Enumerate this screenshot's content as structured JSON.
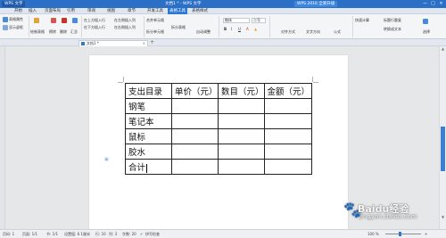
{
  "app": {
    "name": "WPS 文字",
    "title": "文档1 * - WPS 文字",
    "upgrade_label": "WPS 2016 全新升级",
    "window_controls": [
      "—",
      "□",
      "×"
    ]
  },
  "menu": {
    "items": [
      "开始",
      "插入",
      "页面布局",
      "引用",
      "审阅",
      "视图",
      "章节",
      "开发工具",
      "表格工具",
      "表格样式"
    ],
    "active": "表格工具"
  },
  "ribbon": {
    "group1": [
      "表格属性",
      "显示虚框"
    ],
    "group2": [
      "绘制表格",
      "擦除",
      "删除",
      "汇总"
    ],
    "group3": [
      "在上方插入行",
      "在下方插入行",
      "在左侧插入列",
      "在右侧插入列"
    ],
    "group4": [
      "合并单元格",
      "拆分单元格",
      "拆分表格"
    ],
    "autofit": "自动调整",
    "font_name": "楷体",
    "font_size": "二号",
    "format_buttons": [
      "B",
      "I",
      "U",
      "A",
      "▲"
    ],
    "align": "对齐方式",
    "text_direction": "文字方向",
    "formula": "公式",
    "fast_calc": "快速计算",
    "header_repeat": "标题行重复",
    "convert": "转换成文本",
    "select": "选择"
  },
  "doc_tab": {
    "label": "文档1 *",
    "close": "×",
    "add": "+"
  },
  "table": {
    "rows": [
      [
        "支出目录",
        "单价（元）",
        "数目（元）",
        "金额（元）"
      ],
      [
        "钢笔",
        "",
        "",
        ""
      ],
      [
        "笔记本",
        "",
        "",
        ""
      ],
      [
        "鼠标",
        "",
        "",
        ""
      ],
      [
        "胶水",
        "",
        "",
        ""
      ],
      [
        "合计",
        "",
        "",
        ""
      ]
    ]
  },
  "status": {
    "page": "页码: 1",
    "pages": "页面: 1/1",
    "section": "节: 1/1",
    "position": "设置值: 6.1厘米",
    "row": "行: 10",
    "col": "列: 3",
    "words": "字数: 20",
    "spell": "拼写检查",
    "zoom": "100 %"
  },
  "watermark": {
    "brand": "Baidu经验",
    "url": "jingyan.baidu.com"
  },
  "colors": {
    "title_bar": "#2b6fc7",
    "accent": "#2f78d2"
  }
}
